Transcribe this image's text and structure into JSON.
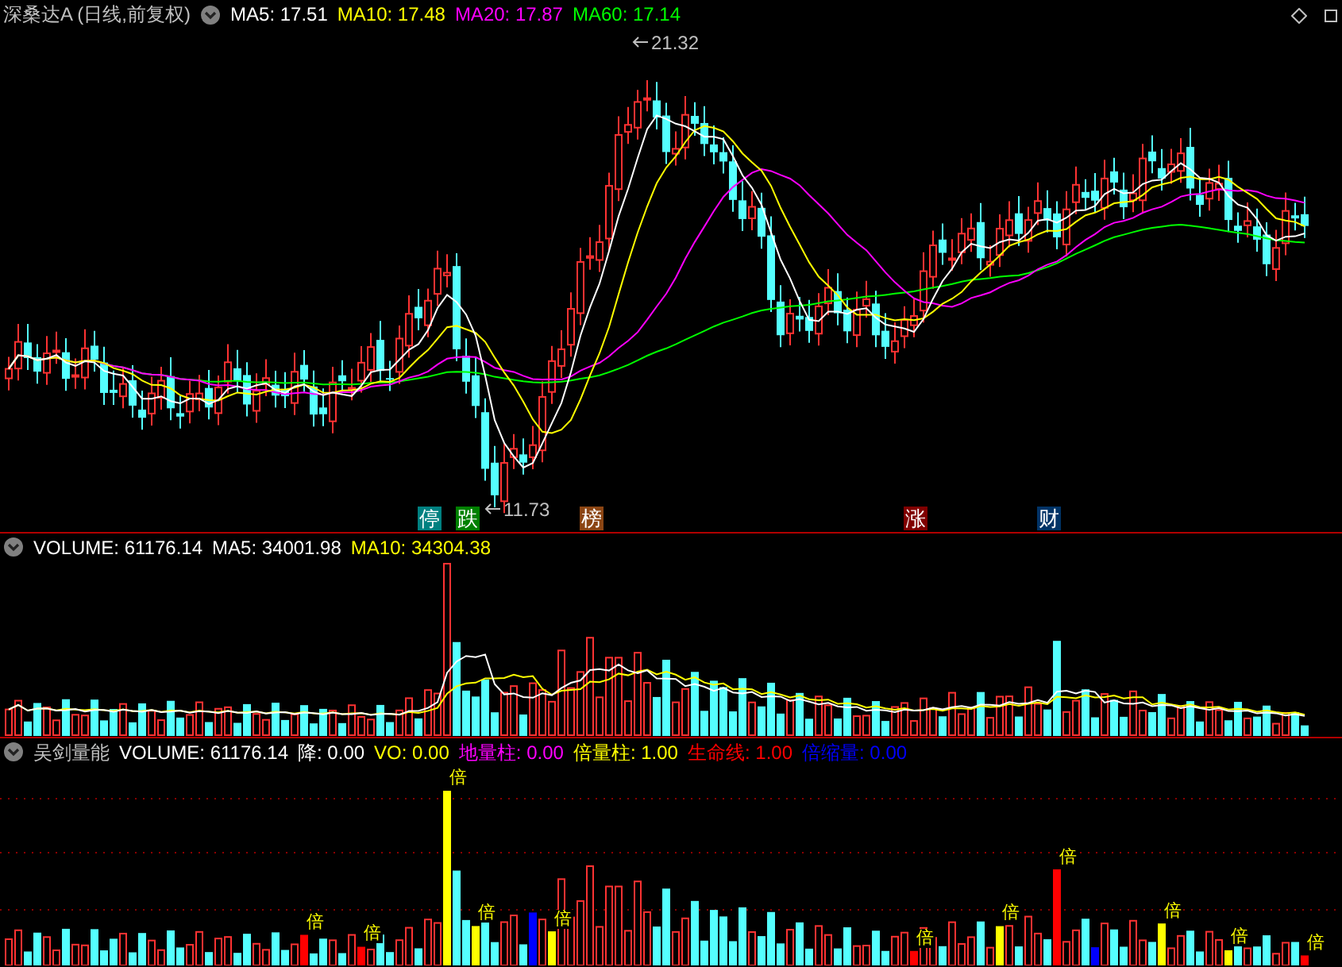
{
  "price_panel": {
    "title": "深桑达A (日线,前复权)",
    "readings": [
      {
        "label": "MA5: 17.51",
        "color": "#ffffff"
      },
      {
        "label": "MA10: 17.48",
        "color": "#ffff00"
      },
      {
        "label": "MA20: 17.87",
        "color": "#ff00ff"
      },
      {
        "label": "MA60: 17.14",
        "color": "#00ff00"
      }
    ],
    "high_label": "21.32",
    "low_label": "11.73",
    "markers": [
      {
        "text": "停",
        "color": "#008080"
      },
      {
        "text": "跌",
        "color": "#008000"
      },
      {
        "text": "榜",
        "color": "#8b4513"
      },
      {
        "text": "涨",
        "color": "#800000"
      },
      {
        "text": "财",
        "color": "#003366"
      }
    ]
  },
  "volume_panel": {
    "readings": [
      {
        "label": "VOLUME: 61176.14",
        "color": "#ffffff"
      },
      {
        "label": "MA5: 34001.98",
        "color": "#ffffff"
      },
      {
        "label": "MA10: 34304.38",
        "color": "#ffff00"
      }
    ]
  },
  "indicator_panel": {
    "title": "吴剑量能",
    "readings": [
      {
        "label": "VOLUME: 61176.14",
        "color": "#ffffff"
      },
      {
        "label": "降: 0.00",
        "color": "#ffffff"
      },
      {
        "label": "VO: 0.00",
        "color": "#ffff00"
      },
      {
        "label": "地量柱: 0.00",
        "color": "#ff00ff"
      },
      {
        "label": "倍量柱: 1.00",
        "color": "#ffff00"
      },
      {
        "label": "生命线: 1.00",
        "color": "#ff0000"
      },
      {
        "label": "倍缩量: 0.00",
        "color": "#0000ff"
      }
    ],
    "bar_marks": [
      "倍",
      "倍",
      "倍",
      "倍",
      "倍",
      "倍",
      "倍",
      "倍",
      "倍",
      "倍",
      "倍"
    ]
  }
}
